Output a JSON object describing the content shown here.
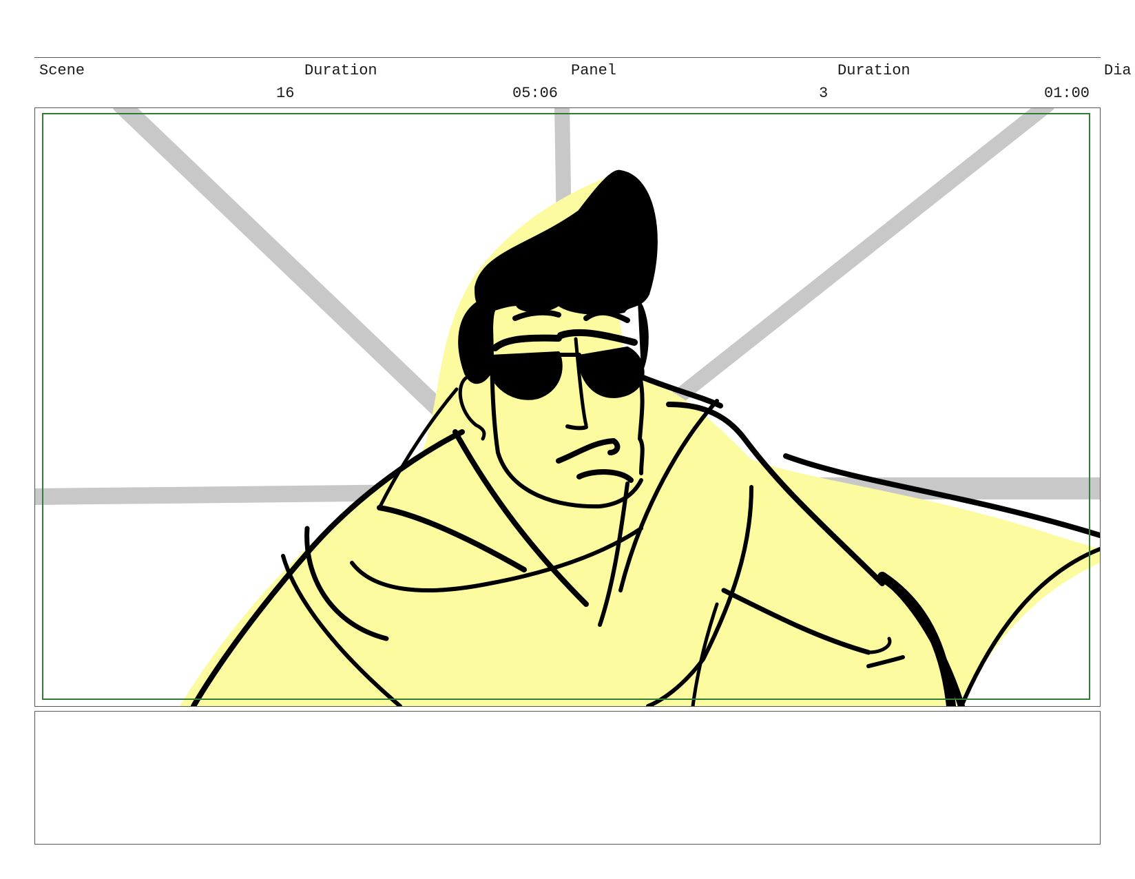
{
  "header": {
    "scene_label": "Scene",
    "scene_duration_label": "Duration",
    "panel_label": "Panel",
    "panel_duration_label": "Duration",
    "dialogue_label": "Dia"
  },
  "values": {
    "scene_number": "16",
    "scene_duration": "05:06",
    "panel_number": "3",
    "panel_duration": "01:00"
  },
  "colors": {
    "safe_frame": "#2e7d32",
    "fill_yellow": "#fdfba0",
    "speed_lines": "#c8c8c8",
    "ink": "#000000"
  },
  "panel": {
    "image": "storyboard-sketch-sunglasses-hero"
  },
  "notes": {
    "text": ""
  }
}
